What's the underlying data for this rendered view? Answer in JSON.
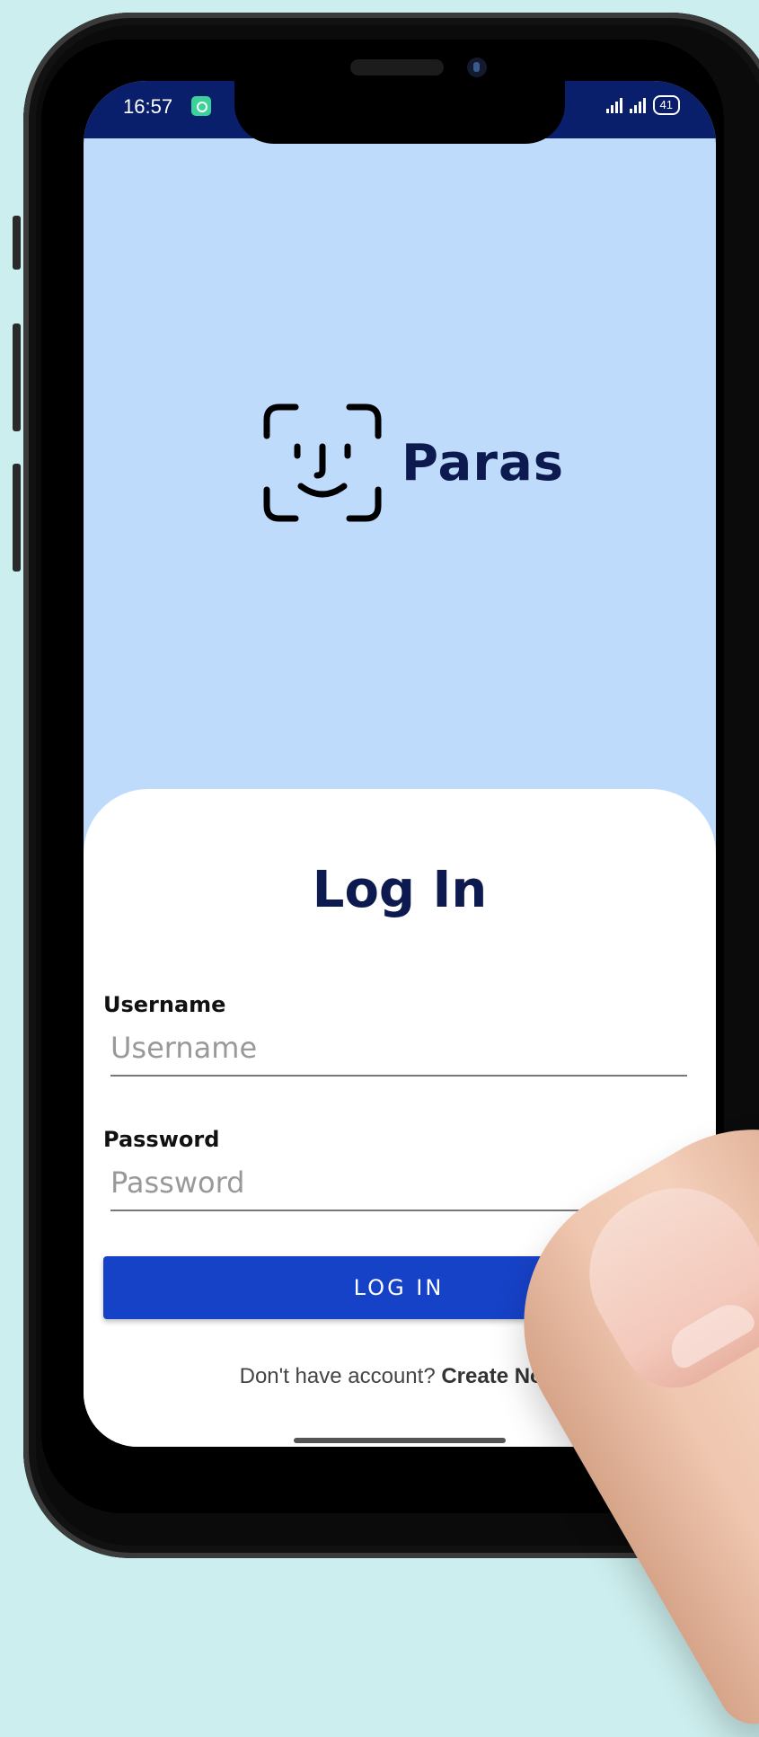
{
  "status_bar": {
    "time": "16:57",
    "battery": "41",
    "background_color": "#0a1f6b"
  },
  "brand": {
    "name": "Paras",
    "logo_icon": "face-id-icon",
    "color": "#0d1a4f"
  },
  "login": {
    "title": "Log In",
    "username_label": "Username",
    "username_placeholder": "Username",
    "password_label": "Password",
    "password_placeholder": "Password",
    "submit_label": "LOG IN",
    "signup_prompt": "Don't have account?",
    "signup_link": "Create Now",
    "accent_color": "#1642c7"
  },
  "colors": {
    "screen_background": "#bfdbfb",
    "page_background": "#cdeeee"
  }
}
